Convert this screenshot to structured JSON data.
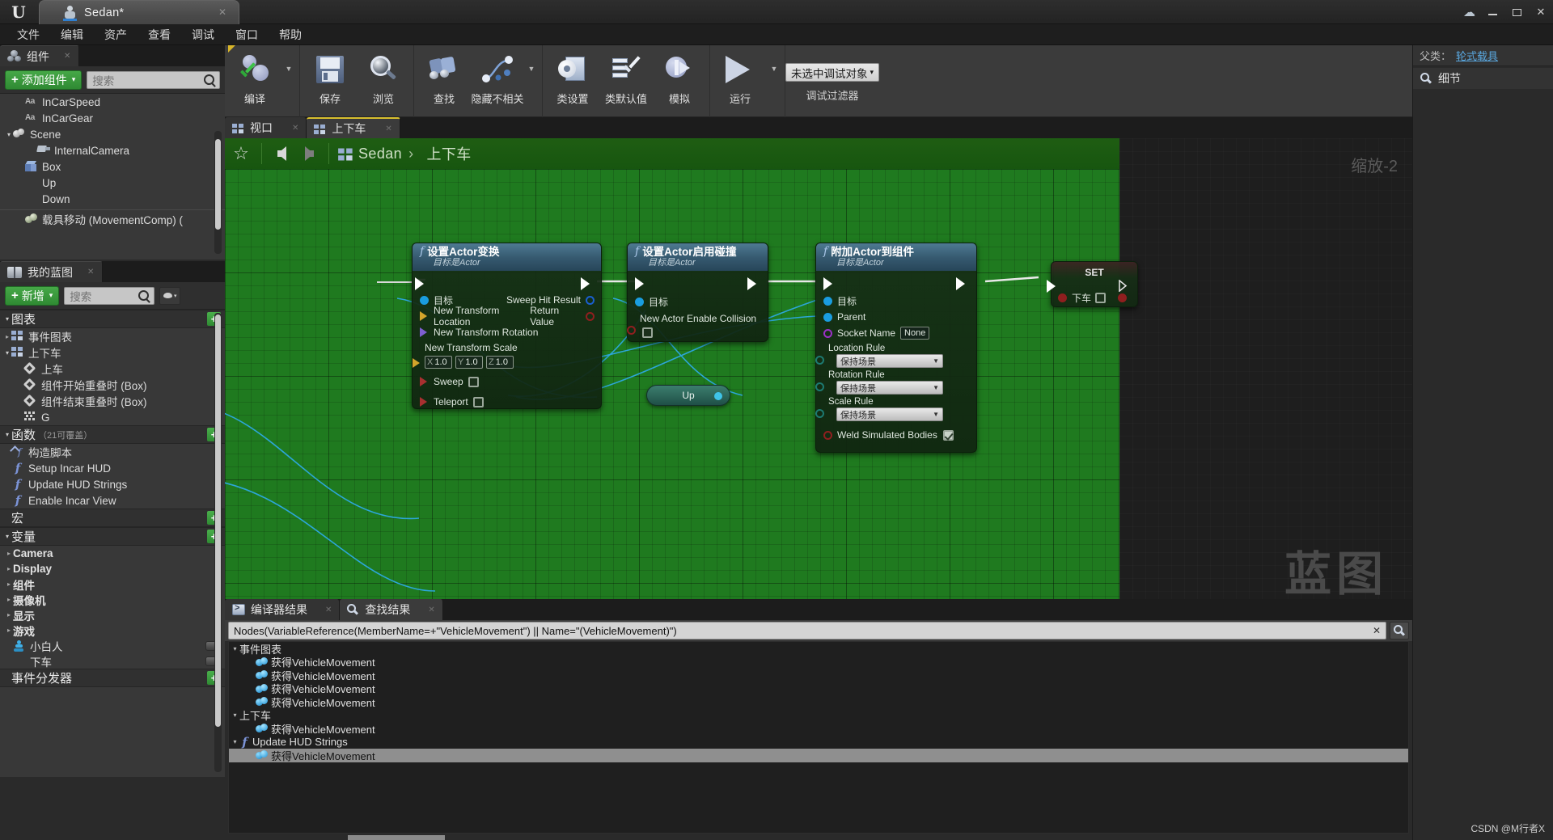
{
  "titlebar": {
    "logo": "U",
    "doc_tab_label": "Sedan*",
    "doc_tab_close": "✕",
    "cloud_icon": "☁",
    "minimize": "–",
    "maximize": "□",
    "close": "✕"
  },
  "menubar": {
    "items": [
      "文件",
      "编辑",
      "资产",
      "查看",
      "调试",
      "窗口",
      "帮助"
    ]
  },
  "components_panel": {
    "tab_label": "组件",
    "tab_close": "✕",
    "add_button": "添加组件",
    "add_plus": "+",
    "add_caret": "▾",
    "search_placeholder": "搜索",
    "items": [
      {
        "label": "InCarSpeed",
        "icon": "text-aa-icon",
        "indent": 1,
        "arrow": ""
      },
      {
        "label": "InCarGear",
        "icon": "text-aa-icon",
        "indent": 1,
        "arrow": ""
      },
      {
        "label": "Scene",
        "icon": "scene-icon",
        "indent": 0,
        "arrow": "▾"
      },
      {
        "label": "InternalCamera",
        "icon": "camera-icon",
        "indent": 2,
        "arrow": ""
      },
      {
        "label": "Box",
        "icon": "box-icon",
        "indent": 1,
        "arrow": ""
      },
      {
        "label": "Up",
        "icon": "sphere-icon",
        "indent": 1,
        "arrow": ""
      },
      {
        "label": "Down",
        "icon": "sphere-icon",
        "indent": 1,
        "arrow": ""
      },
      {
        "label": "载具移动 (MovementComp) (",
        "icon": "movement-comp-icon",
        "indent": 1,
        "arrow": ""
      }
    ]
  },
  "myblueprint_panel": {
    "tab_label": "我的蓝图",
    "tab_close": "✕",
    "add_button": "新增",
    "add_plus": "+",
    "add_caret": "▾",
    "search_placeholder": "搜索",
    "eye_caret": "▾",
    "sections": [
      {
        "title": "图表",
        "sub": "",
        "arrow": "▾",
        "add": "+",
        "items": [
          {
            "label": "事件图表",
            "icon": "graph-icon",
            "indent": 0,
            "arrow": "▸"
          },
          {
            "label": "上下车",
            "icon": "graph-icon",
            "indent": 0,
            "arrow": "▾"
          },
          {
            "label": "上车",
            "icon": "event-diamond-icon",
            "indent": 1,
            "arrow": ""
          },
          {
            "label": "组件开始重叠时 (Box)",
            "icon": "event-diamond-icon",
            "indent": 1,
            "arrow": ""
          },
          {
            "label": "组件结束重叠时 (Box)",
            "icon": "event-diamond-icon",
            "indent": 1,
            "arrow": ""
          },
          {
            "label": "G",
            "icon": "dots-icon",
            "indent": 1,
            "arrow": ""
          }
        ]
      },
      {
        "title": "函数",
        "sub": "（21可覆盖）",
        "arrow": "▾",
        "add": "+",
        "items": [
          {
            "label": "构造脚本",
            "icon": "construction-script-icon",
            "indent": 0,
            "arrow": ""
          },
          {
            "label": "Setup Incar HUD",
            "icon": "function-icon",
            "indent": 0,
            "arrow": ""
          },
          {
            "label": "Update HUD Strings",
            "icon": "function-icon",
            "indent": 0,
            "arrow": ""
          },
          {
            "label": "Enable Incar View",
            "icon": "function-icon",
            "indent": 0,
            "arrow": ""
          }
        ]
      },
      {
        "title": "宏",
        "sub": "",
        "arrow": "",
        "add": "+",
        "items": []
      },
      {
        "title": "变量",
        "sub": "",
        "arrow": "▾",
        "add": "+",
        "items": []
      }
    ],
    "variables": [
      {
        "label": "Camera",
        "arrow": "▸",
        "icon": "",
        "pill": false
      },
      {
        "label": "Display",
        "arrow": "▸",
        "icon": "",
        "pill": false
      },
      {
        "label": "组件",
        "arrow": "▸",
        "icon": "",
        "pill": false
      },
      {
        "label": "摄像机",
        "arrow": "▸",
        "icon": "",
        "pill": false
      },
      {
        "label": "显示",
        "arrow": "▸",
        "icon": "",
        "pill": false
      },
      {
        "label": "游戏",
        "arrow": "▸",
        "icon": "",
        "pill": false
      },
      {
        "label": "小白人",
        "arrow": "",
        "icon": "pawn-icon",
        "pill": true
      },
      {
        "label": "下车",
        "arrow": "",
        "icon": "bool-var-icon",
        "pill": true
      }
    ],
    "event_dispatcher": {
      "title": "事件分发器",
      "add": "+"
    }
  },
  "toolbar": {
    "groups": [
      {
        "items": [
          {
            "label": "编译",
            "icon": "compile-icon",
            "caret": true,
            "flag": true
          }
        ]
      },
      {
        "items": [
          {
            "label": "保存",
            "icon": "save-icon",
            "caret": false,
            "flag": false
          },
          {
            "label": "浏览",
            "icon": "browse-icon",
            "caret": false,
            "flag": false
          }
        ]
      },
      {
        "items": [
          {
            "label": "查找",
            "icon": "find-icon",
            "caret": false,
            "flag": false
          },
          {
            "label": "隐藏不相关",
            "icon": "hide-unrelated-icon",
            "caret": true,
            "flag": false
          }
        ]
      },
      {
        "items": [
          {
            "label": "类设置",
            "icon": "class-settings-icon",
            "caret": false,
            "flag": false
          },
          {
            "label": "类默认值",
            "icon": "class-defaults-icon",
            "caret": false,
            "flag": false
          },
          {
            "label": "模拟",
            "icon": "simulate-icon",
            "caret": false,
            "flag": false
          }
        ]
      },
      {
        "items": [
          {
            "label": "运行",
            "icon": "play-icon",
            "caret": true,
            "flag": false
          }
        ]
      }
    ],
    "debug": {
      "selected": "未选中调试对象",
      "caret": "▾",
      "sublabel": "调试过滤器"
    }
  },
  "graph": {
    "tabs": [
      {
        "label": "视口",
        "active": false,
        "close": "✕"
      },
      {
        "label": "上下车",
        "active": true,
        "close": "✕"
      }
    ],
    "breadcrumb": {
      "star": "☆",
      "root": "Sedan",
      "sep": "›",
      "current": "上下车"
    },
    "zoom_label": "缩放-2",
    "watermark_label": "蓝图",
    "nodes": [
      {
        "id": "set-actor-transform",
        "title": "设置Actor变换",
        "subtitle": "目标是Actor",
        "glyph": "f",
        "inputs": [
          {
            "label": "目标",
            "pin": "circle-blue-filled"
          },
          {
            "label": "New Transform Location",
            "pin": "arrow-yellow"
          },
          {
            "label": "New Transform Rotation",
            "pin": "arrow-purple"
          }
        ],
        "scale_label": "New Transform Scale",
        "scale": {
          "x_axis": "X",
          "x": "1.0",
          "y_axis": "Y",
          "y": "1.0",
          "z_axis": "Z",
          "z": "1.0"
        },
        "bools": [
          {
            "label": "Sweep",
            "checked": false
          },
          {
            "label": "Teleport",
            "checked": false
          }
        ],
        "outputs": [
          {
            "label": "Sweep Hit Result",
            "pin": "circle-blue-ring"
          },
          {
            "label": "Return Value",
            "pin": "circle-red"
          }
        ]
      },
      {
        "id": "set-actor-enable-collision",
        "title": "设置Actor启用碰撞",
        "subtitle": "目标是Actor",
        "glyph": "f",
        "inputs": [
          {
            "label": "目标",
            "pin": "circle-blue-filled"
          }
        ],
        "collision_label": "New Actor Enable Collision",
        "collision_checked": false
      },
      {
        "id": "attach-actor-to-component",
        "title": "附加Actor到组件",
        "subtitle": "目标是Actor",
        "glyph": "f",
        "inputs": [
          {
            "label": "目标",
            "pin": "circle-blue-filled"
          },
          {
            "label": "Parent",
            "pin": "circle-blue-filled"
          }
        ],
        "socket": {
          "label": "Socket Name",
          "value": "None"
        },
        "rules": [
          {
            "label": "Location Rule",
            "value": "保持场景"
          },
          {
            "label": "Rotation Rule",
            "value": "保持场景"
          },
          {
            "label": "Scale Rule",
            "value": "保持场景"
          }
        ],
        "weld": {
          "label": "Weld Simulated Bodies",
          "checked": true
        }
      },
      {
        "id": "set-node",
        "title": "SET",
        "var_label": "下车",
        "var_checked": false
      },
      {
        "id": "up-variable-node",
        "title": "Up"
      }
    ]
  },
  "results_panel": {
    "tabs": [
      {
        "label": "编译器结果",
        "active": false,
        "close": "✕"
      },
      {
        "label": "查找结果",
        "active": true,
        "close": "✕"
      }
    ],
    "search_query": "Nodes(VariableReference(MemberName=+\"VehicleMovement\") || Name=\"(VehicleMovement)\")",
    "clear_icon": "✕",
    "find_icon": "⌕",
    "rows": [
      {
        "label": "事件图表",
        "type": "group",
        "arrow": "▾",
        "selected": false
      },
      {
        "label": "获得VehicleMovement",
        "type": "item",
        "arrow": "",
        "selected": false
      },
      {
        "label": "获得VehicleMovement",
        "type": "item",
        "arrow": "",
        "selected": false
      },
      {
        "label": "获得VehicleMovement",
        "type": "item",
        "arrow": "",
        "selected": false
      },
      {
        "label": "获得VehicleMovement",
        "type": "item",
        "arrow": "",
        "selected": false
      },
      {
        "label": "上下车",
        "type": "group",
        "arrow": "▾",
        "selected": false
      },
      {
        "label": "获得VehicleMovement",
        "type": "item",
        "arrow": "",
        "selected": false
      },
      {
        "label": "Update HUD Strings",
        "type": "function",
        "arrow": "▾",
        "selected": false
      },
      {
        "label": "获得VehicleMovement",
        "type": "item",
        "arrow": "",
        "selected": true
      }
    ]
  },
  "right_panel": {
    "parent_key": "父类：",
    "parent_value": "轮式载具",
    "details_tab": "细节"
  },
  "watermark": "CSDN @M行者X"
}
